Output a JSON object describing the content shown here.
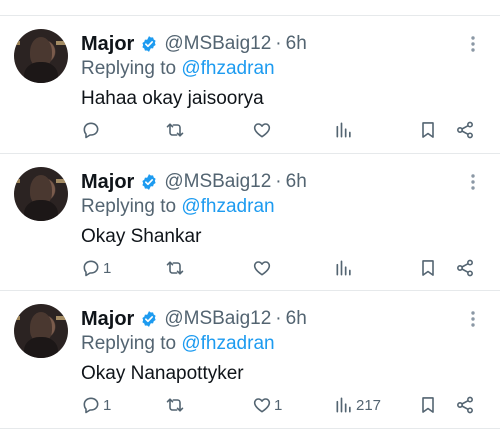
{
  "tweets": [
    {
      "name": "Major",
      "handle": "@MSBaig12",
      "time": "6h",
      "reply_prefix": "Replying to",
      "reply_to": "@fhzadran",
      "text": "Hahaa okay jaisoorya",
      "replies": "",
      "retweets": "",
      "likes": "",
      "views": ""
    },
    {
      "name": "Major",
      "handle": "@MSBaig12",
      "time": "6h",
      "reply_prefix": "Replying to",
      "reply_to": "@fhzadran",
      "text": "Okay Shankar",
      "replies": "1",
      "retweets": "",
      "likes": "",
      "views": ""
    },
    {
      "name": "Major",
      "handle": "@MSBaig12",
      "time": "6h",
      "reply_prefix": "Replying to",
      "reply_to": "@fhzadran",
      "text": "Okay Nanapottyker",
      "replies": "1",
      "retweets": "",
      "likes": "1",
      "views": "217"
    }
  ],
  "colors": {
    "accent": "#1d9bf0",
    "text_primary": "#0f1419",
    "text_secondary": "#536471",
    "divider": "#e6e9eb"
  },
  "icons": [
    "verified-badge-icon",
    "more-icon",
    "reply-icon",
    "retweet-icon",
    "like-icon",
    "views-icon",
    "bookmark-icon",
    "share-icon"
  ]
}
